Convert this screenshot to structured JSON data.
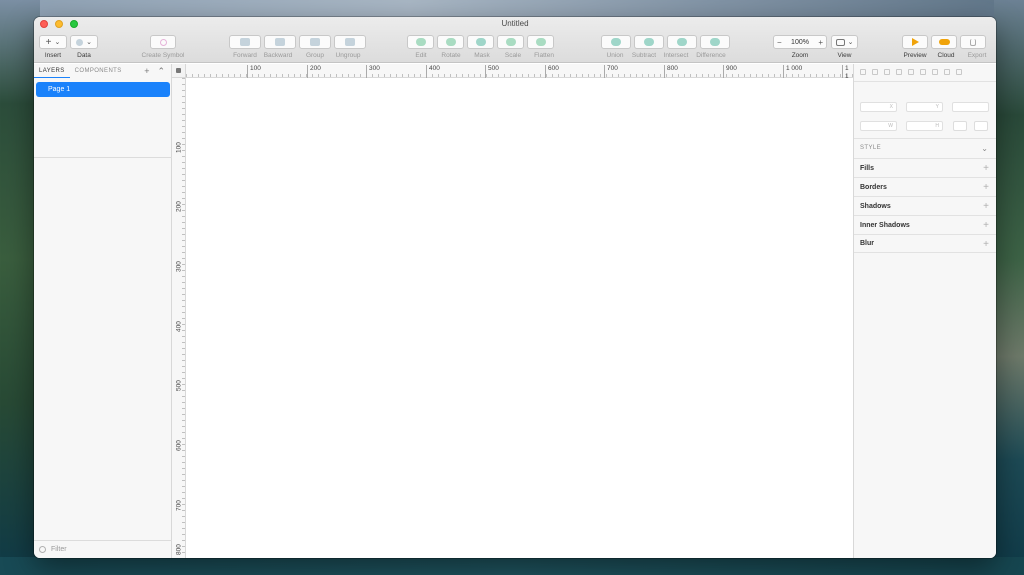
{
  "window": {
    "title": "Untitled"
  },
  "toolbar": {
    "insert": "Insert",
    "data": "Data",
    "create_symbol": "Create Symbol",
    "forward": "Forward",
    "backward": "Backward",
    "group": "Group",
    "ungroup": "Ungroup",
    "edit": "Edit",
    "rotate": "Rotate",
    "mask": "Mask",
    "scale": "Scale",
    "flatten": "Flatten",
    "union": "Union",
    "subtract": "Subtract",
    "intersect": "Intersect",
    "difference": "Difference",
    "zoom_value": "100%",
    "zoom": "Zoom",
    "view": "View",
    "preview": "Preview",
    "cloud": "Cloud",
    "export": "Export",
    "zoom_minus": "−",
    "zoom_plus": "+",
    "insert_glyph": "+",
    "chevron": "⌄"
  },
  "left_panel": {
    "tab_layers": "LAYERS",
    "tab_components": "COMPONENTS",
    "add_glyph": "+",
    "collapse_glyph": "⌃",
    "pages": [
      "Page 1"
    ],
    "filter_placeholder": "Filter"
  },
  "rulers": {
    "horizontal": [
      "100",
      "200",
      "300",
      "400",
      "500",
      "600",
      "700",
      "800",
      "900",
      "1 000",
      "1 1"
    ],
    "vertical": [
      "100",
      "200",
      "300",
      "400",
      "500",
      "600",
      "700",
      "800"
    ]
  },
  "inspector": {
    "field_x": "X",
    "field_y": "Y",
    "field_w": "W",
    "field_h": "H",
    "style_header": "STYLE",
    "style_chevron": "⌄",
    "rows": [
      "Fills",
      "Borders",
      "Shadows",
      "Inner Shadows",
      "Blur"
    ],
    "plus": "+"
  }
}
